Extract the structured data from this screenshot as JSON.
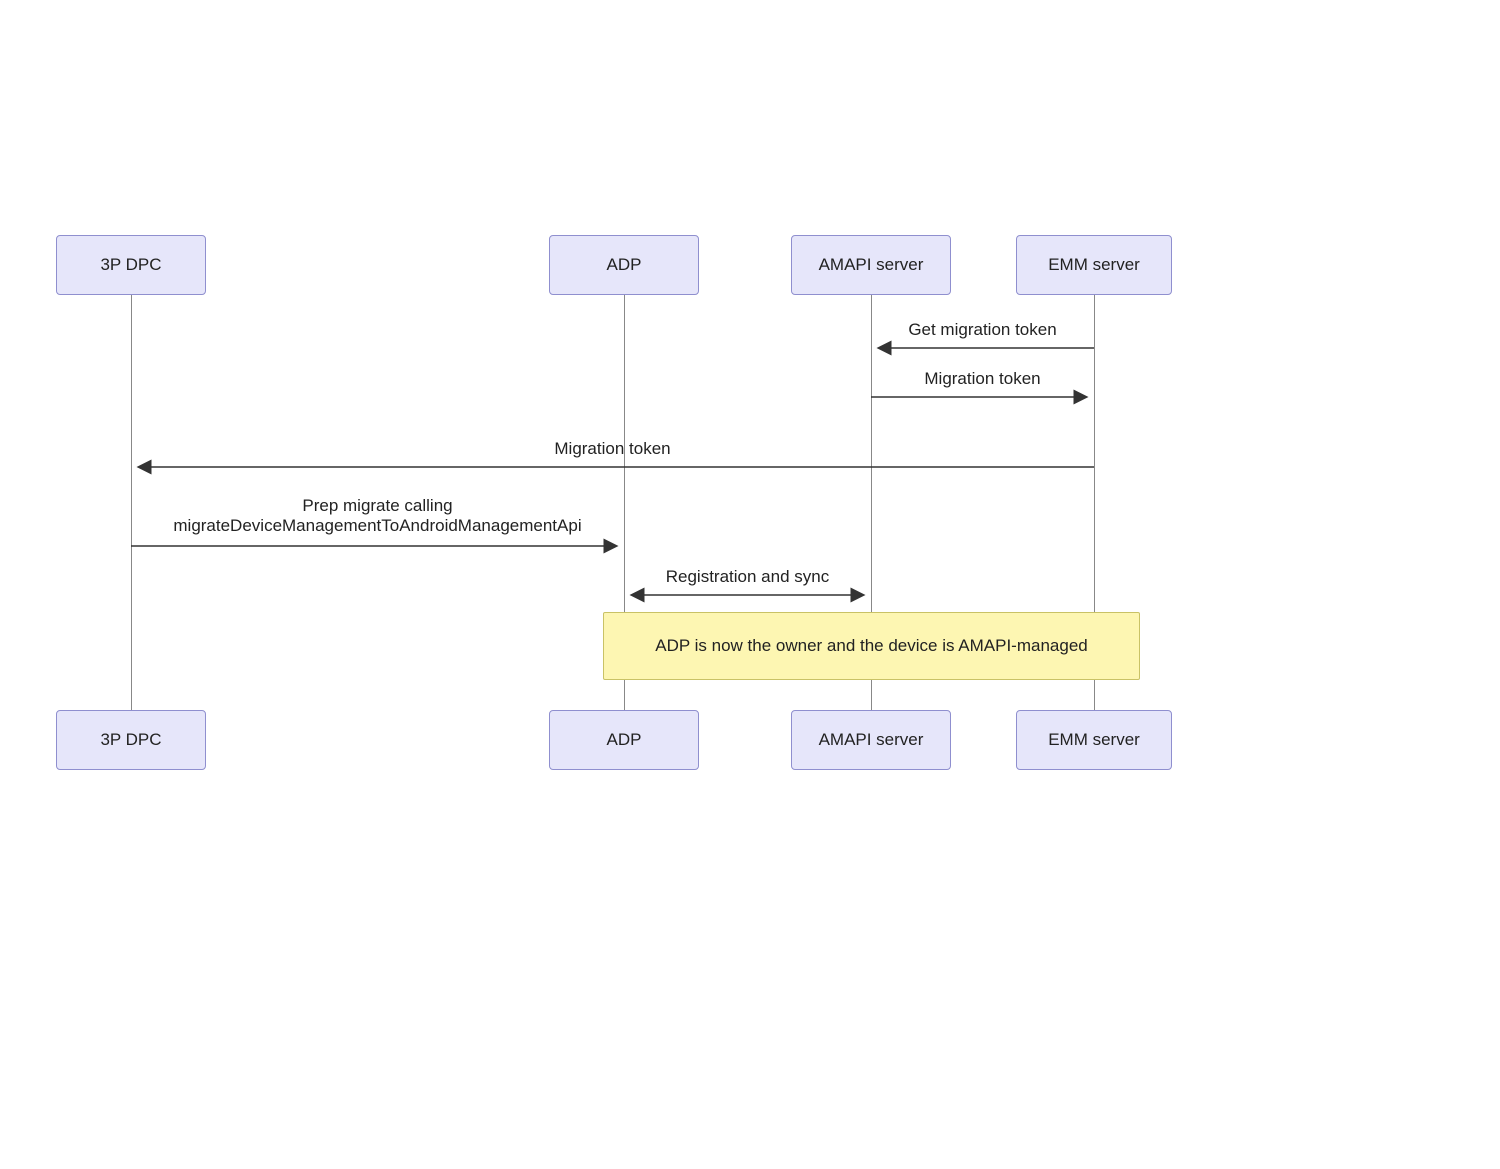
{
  "actors": {
    "a0": "3P DPC",
    "a1": "ADP",
    "a2": "AMAPI server",
    "a3": "EMM server"
  },
  "messages": {
    "m1": "Get migration token",
    "m2": "Migration token",
    "m3": "Migration token",
    "m4": "Prep migrate calling\nmigrateDeviceManagementToAndroidManagementApi",
    "m5": "Registration and sync"
  },
  "note": "ADP is now the owner\nand the device is AMAPI-managed"
}
